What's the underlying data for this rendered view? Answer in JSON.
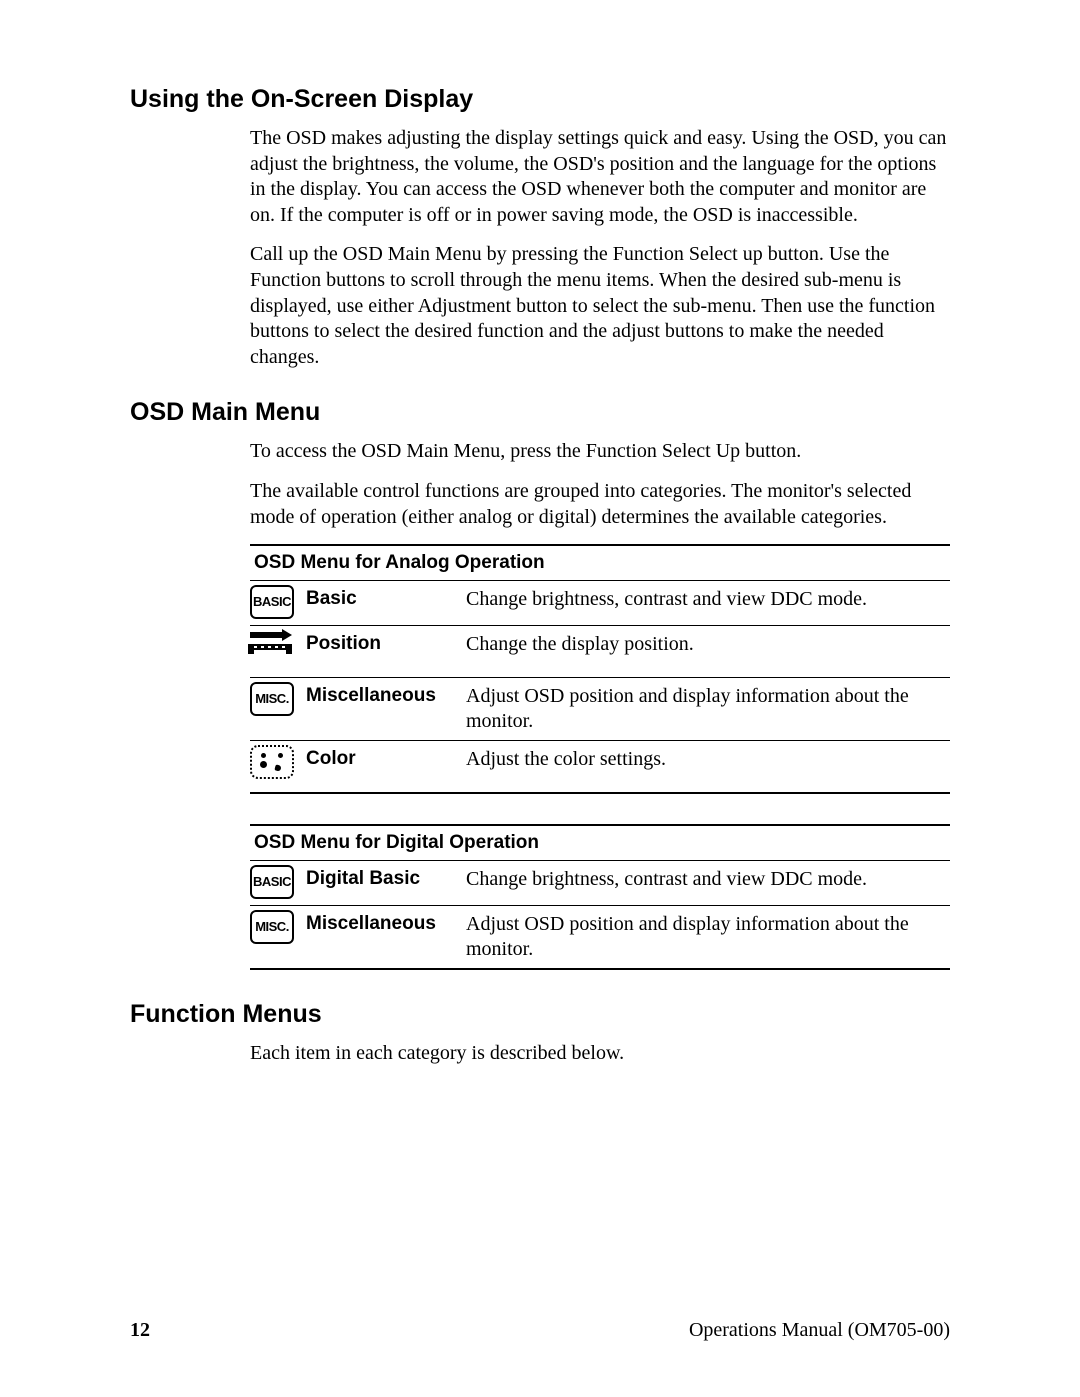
{
  "sections": {
    "s1": {
      "title": "Using the On-Screen Display",
      "p1": "The OSD makes adjusting the display settings quick and easy. Using the OSD, you can adjust the brightness, the volume, the OSD's position and the language for the options in the display. You can access the OSD whenever both the computer and monitor are on. If the computer is off or in power saving mode, the OSD is inaccessible.",
      "p2": "Call up the OSD Main Menu by pressing the Function Select up button. Use the Function buttons to scroll through the menu items. When the desired sub-menu is displayed, use either Adjustment button to select the sub-menu. Then use the function buttons to select the desired function and the adjust buttons to make the needed changes."
    },
    "s2": {
      "title": "OSD Main Menu",
      "p1": "To access the OSD Main Menu, press the Function Select Up button.",
      "p2": "The available control functions are grouped into categories. The monitor's selected mode of operation (either analog or digital) determines the available categories."
    },
    "s3": {
      "title": "Function Menus",
      "p1": "Each item in each category is described below."
    }
  },
  "tables": {
    "analog": {
      "heading": "OSD Menu for Analog Operation",
      "rows": [
        {
          "iconText": "BASIC",
          "iconType": "box",
          "name": "Basic",
          "desc": "Change brightness, contrast and view DDC mode."
        },
        {
          "iconText": "",
          "iconType": "position",
          "name": "Position",
          "desc": "Change the display position."
        },
        {
          "iconText": "MISC.",
          "iconType": "box",
          "name": "Miscellaneous",
          "desc": "Adjust OSD position and display information about the monitor."
        },
        {
          "iconText": "",
          "iconType": "color",
          "name": "Color",
          "desc": "Adjust the color settings."
        }
      ]
    },
    "digital": {
      "heading": "OSD Menu for Digital Operation",
      "rows": [
        {
          "iconText": "BASIC",
          "iconType": "box",
          "name": "Digital Basic",
          "desc": "Change brightness, contrast and view DDC mode."
        },
        {
          "iconText": "MISC.",
          "iconType": "box",
          "name": "Miscellaneous",
          "desc": "Adjust OSD position and display information about the monitor."
        }
      ]
    }
  },
  "icons": {
    "basic": "BASIC",
    "misc": "MISC."
  },
  "footer": {
    "page": "12",
    "label": "Operations Manual (OM705-00)"
  }
}
